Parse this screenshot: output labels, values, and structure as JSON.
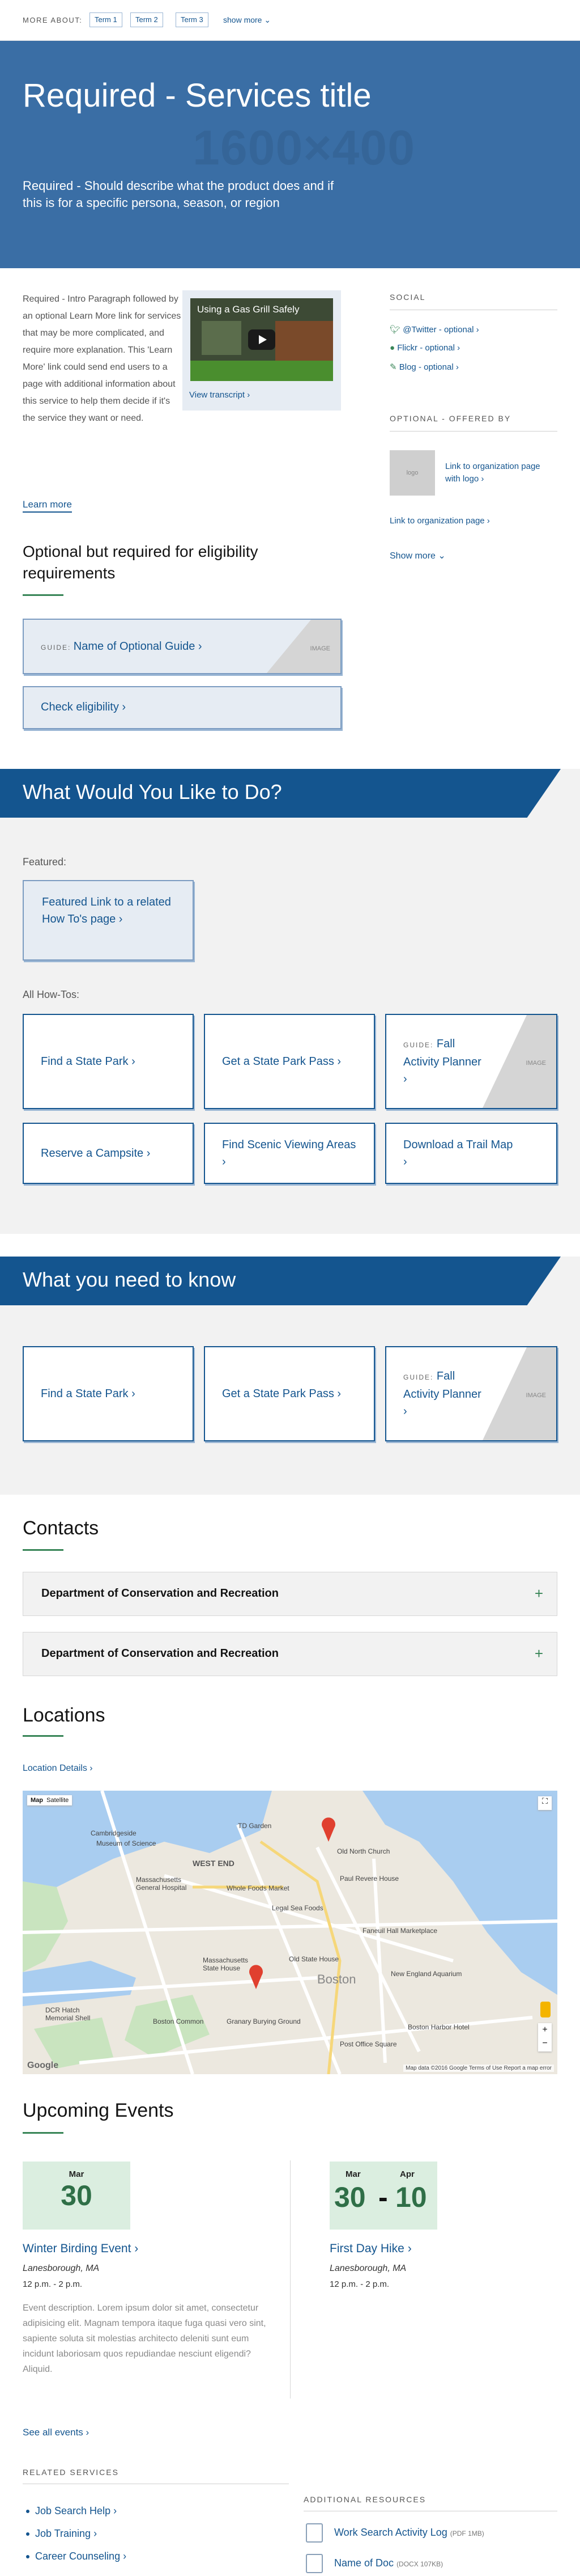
{
  "topbar": {
    "label": "MORE ABOUT:",
    "tags": [
      "Term 1",
      "Term 2",
      "Term 3"
    ],
    "show_more": "show more"
  },
  "hero": {
    "title": "Required - Services title",
    "placeholder": "1600×400",
    "description": "Required - Should describe what the product does and if this is for a specific persona, season, or region"
  },
  "intro": {
    "text": "Required - Intro Paragraph followed by an optional Learn More link for services that may be more complicated, and require more explanation. This 'Learn More' link could send end users to a page with additional information about this service to help them decide if it's the service they want or need.",
    "learn_more": "Learn more",
    "video_title": "Using a Gas Grill Safely",
    "view_transcript": "View transcript"
  },
  "social": {
    "heading": "SOCIAL",
    "items": [
      "@Twitter - optional",
      "Flickr - optional",
      "Blog - optional"
    ]
  },
  "offered": {
    "heading": "OPTIONAL - OFFERED BY",
    "logo": "logo",
    "org_logo_link": "Link to organization page with logo",
    "org_link": "Link to organization page",
    "show_more": "Show more"
  },
  "eligibility": {
    "heading": "Optional but required for eligibility requirements",
    "guide_label": "GUIDE:",
    "guide_title": "Name of Optional Guide",
    "guide_image": "IMAGE",
    "check": "Check eligibility"
  },
  "todo": {
    "heading": "What Would You Like to Do?",
    "featured_label": "Featured:",
    "featured_link": "Featured Link to a related How To's page",
    "all_label": "All How-Tos:",
    "cards": [
      {
        "title": "Find a State Park"
      },
      {
        "title": "Get a State Park Pass"
      },
      {
        "guide": "GUIDE:",
        "title": "Fall Activity Planner",
        "image": "IMAGE"
      },
      {
        "title": "Reserve a Campsite"
      },
      {
        "title": "Find Scenic Viewing Areas"
      },
      {
        "title": "Download a Trail Map"
      }
    ]
  },
  "know": {
    "heading": "What you need to know",
    "cards": [
      {
        "title": "Find a State Park"
      },
      {
        "title": "Get a State Park Pass"
      },
      {
        "guide": "GUIDE:",
        "title": "Fall Activity Planner",
        "image": "IMAGE"
      }
    ]
  },
  "contacts": {
    "heading": "Contacts",
    "items": [
      "Department of Conservation and Recreation",
      "Department of Conservation and Recreation"
    ]
  },
  "locations": {
    "heading": "Locations",
    "details": "Location Details",
    "map_tabs": [
      "Map",
      "Satellite"
    ],
    "map_labels": [
      "Cambridgeside",
      "Museum of Science",
      "WEST END",
      "TD Garden",
      "Old North Church",
      "Paul Revere House",
      "Massachusetts General Hospital",
      "Whole Foods Market",
      "Faneuil Hall Marketplace",
      "Massachusetts State House",
      "Old State House",
      "Boston",
      "New England Aquarium",
      "Boston Common",
      "Granary Burying Ground",
      "DCR Hatch Memorial Shell",
      "Post Office Square",
      "Boston Harbor Hotel",
      "Legal Sea Foods"
    ],
    "map_footer": "Map data ©2016 Google   Terms of Use   Report a map error",
    "google": "Google"
  },
  "events": {
    "heading": "Upcoming Events",
    "items": [
      {
        "month": "Mar",
        "day": "30",
        "title": "Winter Birding Event",
        "place": "Lanesborough, MA",
        "time": "12 p.m. - 2 p.m.",
        "description": "Event description. Lorem ipsum dolor sit amet, consectetur adipisicing elit. Magnam tempora itaque fuga quasi vero sint, sapiente soluta sit molestias architecto deleniti sunt eum incidunt laboriosam quos repudiandae nesciunt eligendi? Aliquid."
      },
      {
        "month": "Mar",
        "month2": "Apr",
        "day": "30",
        "dash": "-",
        "day2": "10",
        "title": "First Day Hike",
        "place": "Lanesborough, MA",
        "time": "12 p.m. - 2 p.m."
      }
    ],
    "see_all": "See all events"
  },
  "related": {
    "heading": "RELATED SERVICES",
    "items": [
      "Job Search Help",
      "Job Training",
      "Career Counseling"
    ]
  },
  "resources": {
    "heading": "ADDITIONAL RESOURCES",
    "items": [
      {
        "label": "Work Search Activity Log",
        "meta": "(PDF 1MB)"
      },
      {
        "label": "Name of Doc",
        "meta": "(DOCX 107KB)"
      }
    ]
  },
  "colors": {
    "brand_blue": "#14558f",
    "hero_bg": "#3a6ea5",
    "accent_green": "#388557",
    "event_box": "#dbeee0"
  },
  "icons": [
    "twitter-icon",
    "flickr-icon",
    "blog-icon",
    "play-icon",
    "plus-icon",
    "map-pin-icon",
    "document-icon",
    "chevron-right-icon"
  ]
}
